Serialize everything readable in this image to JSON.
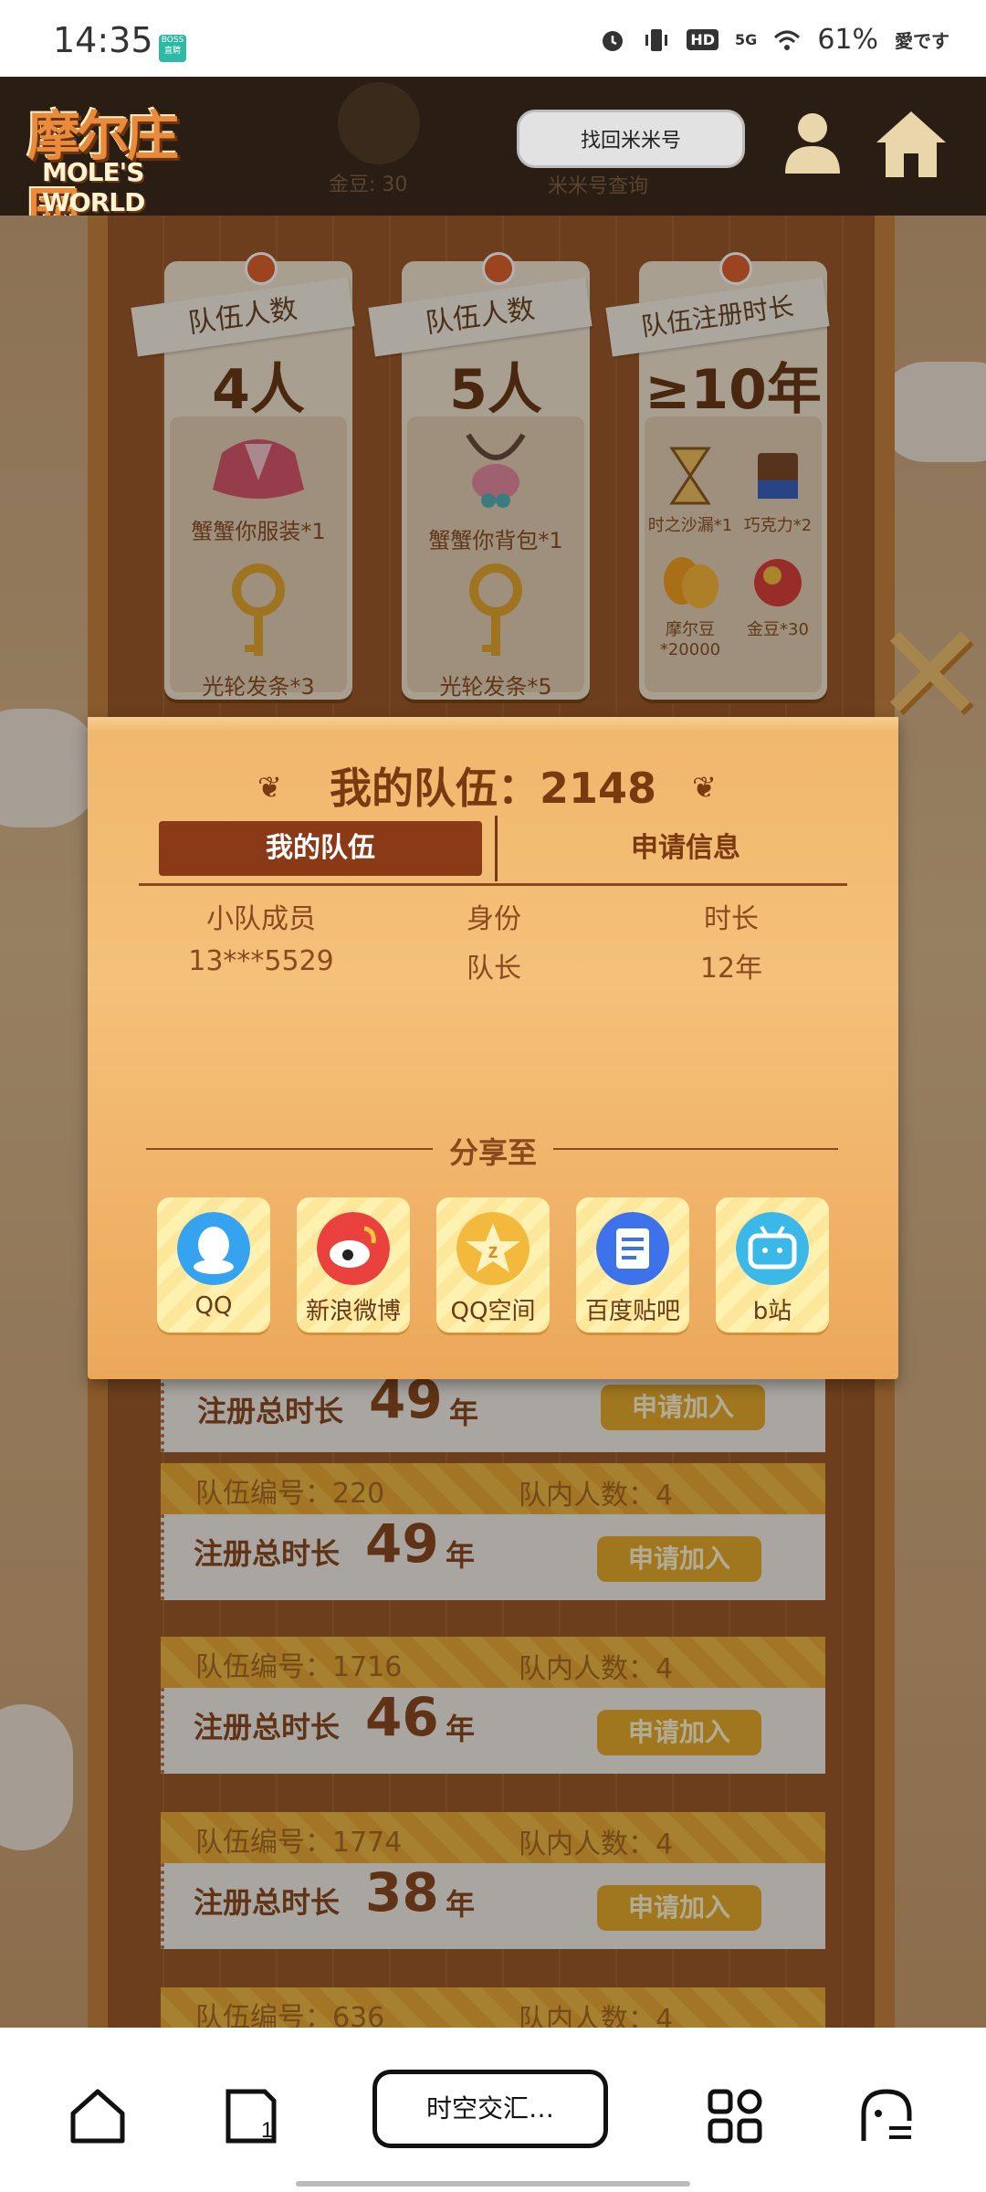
{
  "status_bar": {
    "time": "14:35",
    "app_badge": "BOSS直聘",
    "network": "5G",
    "hd": "HD",
    "battery": "61%",
    "brand": "愛です"
  },
  "top_nav": {
    "logo_main": "摩尔庄园",
    "logo_sub": "MOLE'S WORLD",
    "ghost_label_1": "金豆: 30",
    "ghost_label_2": "米米号查询",
    "find_mimi_label": "找回米米号"
  },
  "reward_cards": [
    {
      "tag": "队伍人数",
      "value": "4人",
      "items": [
        {
          "name": "蟹蟹你服装*1",
          "icon": "clothing-icon"
        },
        {
          "name": "光轮发条*3",
          "icon": "key-icon"
        }
      ]
    },
    {
      "tag": "队伍人数",
      "value": "5人",
      "items": [
        {
          "name": "蟹蟹你背包*1",
          "icon": "backpack-icon"
        },
        {
          "name": "光轮发条*5",
          "icon": "key-icon"
        }
      ]
    },
    {
      "tag": "队伍注册时长",
      "value": "≥10年",
      "items": [
        {
          "name": "时之沙漏*1",
          "icon": "hourglass-icon"
        },
        {
          "name": "巧克力*2",
          "icon": "chocolate-icon"
        },
        {
          "name": "摩尔豆*20000",
          "icon": "mole-bean-icon"
        },
        {
          "name": "金豆*30",
          "icon": "gold-bean-icon"
        }
      ]
    }
  ],
  "team_list": {
    "id_label": "队伍编号：",
    "count_label": "队内人数：",
    "reg_label": "注册总时长",
    "year_unit": "年",
    "join_label": "申请加入",
    "rows": [
      {
        "id": "",
        "count": "",
        "years": "49"
      },
      {
        "id": "220",
        "count": "4",
        "years": "49"
      },
      {
        "id": "1716",
        "count": "4",
        "years": "46"
      },
      {
        "id": "1774",
        "count": "4",
        "years": "38"
      },
      {
        "id": "636",
        "count": "4",
        "years": ""
      }
    ]
  },
  "modal": {
    "title": "我的队伍：2148",
    "tab_active": "我的队伍",
    "tab_inactive": "申请信息",
    "headers": [
      "小队成员",
      "身份",
      "时长"
    ],
    "member": {
      "name": "13***5529",
      "role": "队长",
      "duration": "12年"
    },
    "share_label": "分享至",
    "share_targets": [
      {
        "label": "QQ",
        "icon": "qq-icon",
        "color": "#35a3f0"
      },
      {
        "label": "新浪微博",
        "icon": "weibo-icon",
        "color": "#e8413e"
      },
      {
        "label": "QQ空间",
        "icon": "qzone-icon",
        "color": "#f3b93c"
      },
      {
        "label": "百度贴吧",
        "icon": "tieba-icon",
        "color": "#3d72ea"
      },
      {
        "label": "b站",
        "icon": "bilibili-icon",
        "color": "#3cb8e8"
      }
    ]
  },
  "bottom_bar": {
    "center_label": "时空交汇…",
    "tab_count": "1"
  }
}
